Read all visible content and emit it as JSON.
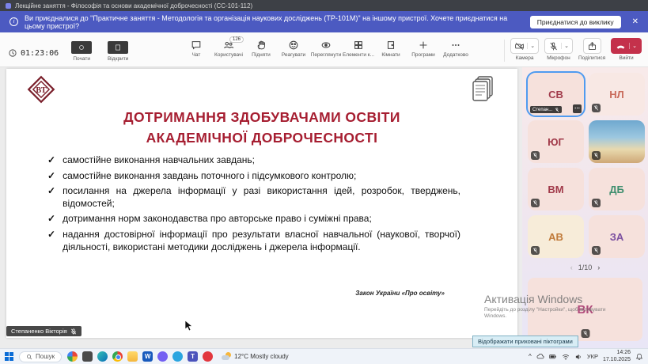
{
  "colors": {
    "notification_blue": "#4c5ac1",
    "leave_red": "#c4314b",
    "slide_title_red": "#a61e31",
    "active_tile_border": "#4f9bf0"
  },
  "icons": {
    "check": "✓",
    "more": "⋯",
    "chevron_down": "⌄",
    "caret_up": "^",
    "prev": "‹",
    "next": "›",
    "close": "✕",
    "info": "i"
  },
  "window": {
    "title": "Лекційне заняття - Філософія та основи академічної доброчесності (СС-101-112)"
  },
  "notification": {
    "text": "Ви приєдналися до \"Практичне заняття - Методологія та організація наукових досліджень (ТР-101М)\" на іншому пристрої. Хочете приєднатися на цьому пристрої?",
    "join_button": "Приєднатися до виклику"
  },
  "toolbar": {
    "timer": "01:23:06",
    "start_label": "Почати",
    "open_label": "Відкрити",
    "buttons": [
      {
        "label": "Чат"
      },
      {
        "label": "Користувачі",
        "badge": "126"
      },
      {
        "label": "Підняти"
      },
      {
        "label": "Реагувати"
      },
      {
        "label": "Переглянути"
      },
      {
        "label": "Елементи к..."
      },
      {
        "label": "Кімнати"
      },
      {
        "label": "Програми"
      },
      {
        "label": "Додатково"
      }
    ],
    "camera_label": "Камера",
    "mic_label": "Мікрофон",
    "share_label": "Поділитися",
    "leave_label": "Вийти"
  },
  "slide": {
    "bullet_marker": "✓",
    "title_line1": "ДОТРИМАННЯ ЗДОБУВАЧАМИ ОСВІТИ",
    "title_line2": "АКАДЕМІЧНОЇ ДОБРОЧЕСНОСТІ",
    "bullets": [
      "самостійне виконання навчальних завдань;",
      "самостійне виконання завдань поточного і підсумкового контролю;",
      "посилання на джерела інформації у разі використання ідей, розробок, тверджень, відомостей;",
      "дотримання норм законодавства про авторське право і суміжні права;",
      "надання достовірної інформації про результати власної навчальної (наукової, творчої) діяльності, використані методики досліджень і джерела інформації."
    ],
    "source": "Закон України «Про освіту»",
    "presenter": "Степаненко Вікторія"
  },
  "participants": {
    "tiles": [
      {
        "initials": "СВ",
        "name_label": "Степан..."
      },
      {
        "initials": "НЛ"
      },
      {
        "initials": "ЮГ"
      },
      {
        "initials": ""
      },
      {
        "initials": "ВМ"
      },
      {
        "initials": "ДБ"
      },
      {
        "initials": "АВ"
      },
      {
        "initials": "ЗА"
      }
    ],
    "page": "1/10",
    "self": {
      "initials": "ВК"
    }
  },
  "watermark": {
    "title": "Активація Windows",
    "subtitle": "Перейдіть до розділу \"Настройки\", щоб активувати Windows."
  },
  "tooltip": "Відображати приховані піктограми",
  "taskbar": {
    "search": "Пошук",
    "weather": "12°C  Mostly cloudy",
    "lang": "УКР",
    "time": "14:26",
    "date": "17.10.2025"
  }
}
